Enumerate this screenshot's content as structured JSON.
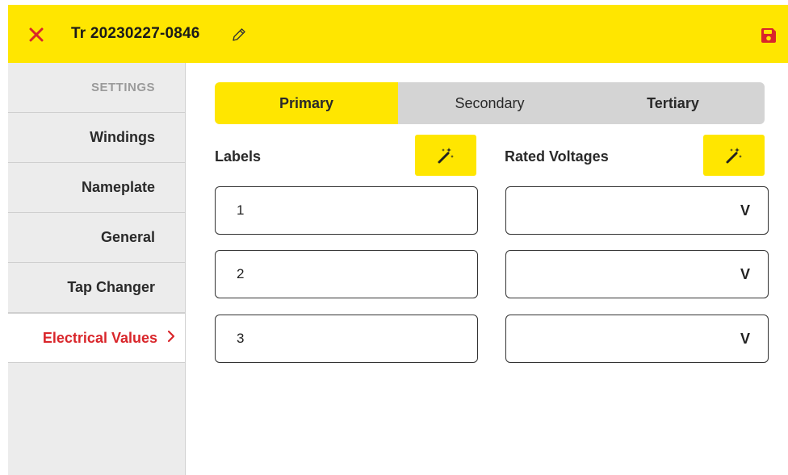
{
  "header": {
    "title": "Tr 20230227-0846",
    "close_icon": "close-icon",
    "edit_icon": "pencil-icon",
    "save_icon": "floppy-disk-icon",
    "background_color": "#FFE600",
    "accent_color": "#D9262B"
  },
  "sidebar": {
    "header": "SETTINGS",
    "items": [
      {
        "label": "Windings"
      },
      {
        "label": "Nameplate"
      },
      {
        "label": "General"
      },
      {
        "label": "Tap Changer"
      },
      {
        "label": "Electrical Values",
        "active": true,
        "icon": "chevron-right-icon"
      }
    ]
  },
  "tabs": [
    {
      "label": "Primary",
      "active": true
    },
    {
      "label": "Secondary"
    },
    {
      "label": "Tertiary"
    }
  ],
  "labels_column": {
    "title": "Labels",
    "auto_fill_icon": "magic-wand-icon",
    "values": [
      "1",
      "2",
      "3"
    ]
  },
  "voltages_column": {
    "title": "Rated Voltages",
    "auto_fill_icon": "magic-wand-icon",
    "unit": "V",
    "values": [
      "",
      "",
      ""
    ]
  }
}
